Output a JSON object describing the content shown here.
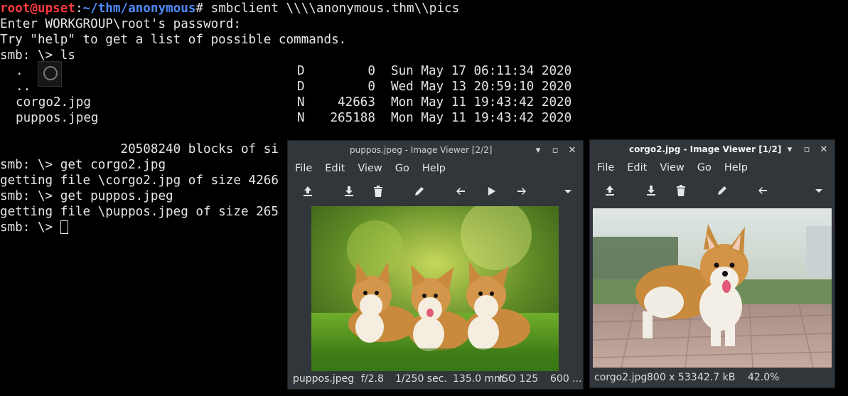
{
  "terminal": {
    "prompt": {
      "user": "root",
      "at": "@",
      "host": "upset",
      "sep": ":",
      "path": "~/thm/anonymous",
      "sym": "# ",
      "command": "smbclient \\\\\\\\anonymous.thm\\\\pics"
    },
    "lines": [
      "Enter WORKGROUP\\root's password:",
      "Try \"help\" to get a list of possible commands.",
      "smb: \\> ls"
    ],
    "listing": [
      {
        "name": ".",
        "attr": "D",
        "size": "0",
        "date": "Sun May 17 06:11:34 2020"
      },
      {
        "name": "..",
        "attr": "D",
        "size": "0",
        "date": "Wed May 13 20:59:10 2020"
      },
      {
        "name": "corgo2.jpg",
        "attr": "N",
        "size": "42663",
        "date": "Mon May 11 19:43:42 2020"
      },
      {
        "name": "puppos.jpeg",
        "attr": "N",
        "size": "265188",
        "date": "Mon May 11 19:43:42 2020"
      }
    ],
    "blocks_line": "                20508240 blocks of si",
    "after": [
      "smb: \\> get corgo2.jpg",
      "getting file \\corgo2.jpg of size 4266",
      "smb: \\> get puppos.jpeg",
      "getting file \\puppos.jpeg of size 265",
      "smb: \\> "
    ]
  },
  "viewer_left": {
    "title": "puppos.jpeg - Image Viewer [2/2]",
    "menus": [
      "File",
      "Edit",
      "View",
      "Go",
      "Help"
    ],
    "status": {
      "name": "puppos.jpeg",
      "aperture": "f/2.8",
      "shutter": "1/250 sec.",
      "focal": "135.0 mm",
      "iso": "ISO 125",
      "dims": "600 ..."
    }
  },
  "viewer_right": {
    "title": "corgo2.jpg - Image Viewer [1/2]",
    "menus": [
      "File",
      "Edit",
      "View",
      "Go",
      "Help"
    ],
    "status": {
      "name": "corgo2.jpg",
      "dims": "800 x 533",
      "size": "42.7 kB",
      "zoom": "42.0%"
    }
  },
  "window_buttons": {
    "minimize": "▾",
    "maximize": "▫",
    "close": "✕"
  },
  "colors": {
    "prompt_user": "#ff3b3b",
    "prompt_path": "#4f8cff",
    "window_bg": "#31363b"
  }
}
